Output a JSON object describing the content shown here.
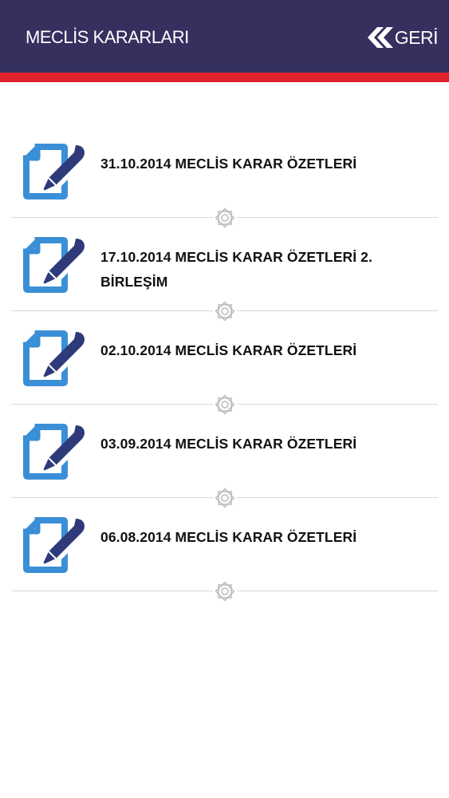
{
  "header": {
    "title": "MECLİS KARARLARI",
    "back_label": "GERİ"
  },
  "colors": {
    "header_bg": "#36305f",
    "accent_stripe": "#e1222e",
    "icon_blue": "#3a8fd6",
    "icon_pen": "#2e3a7a"
  },
  "items": [
    {
      "label": "31.10.2014 MECLİS KARAR ÖZETLERİ",
      "icon": "document-edit-icon"
    },
    {
      "label": "17.10.2014 MECLİS KARAR ÖZETLERİ 2. BİRLEŞİM",
      "icon": "document-edit-icon"
    },
    {
      "label": "02.10.2014 MECLİS KARAR ÖZETLERİ",
      "icon": "document-edit-icon"
    },
    {
      "label": "03.09.2014 MECLİS KARAR ÖZETLERİ",
      "icon": "document-edit-icon"
    },
    {
      "label": "06.08.2014 MECLİS KARAR ÖZETLERİ",
      "icon": "document-edit-icon"
    }
  ]
}
